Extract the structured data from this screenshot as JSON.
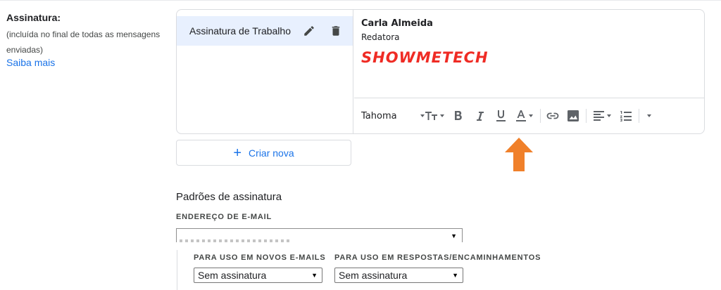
{
  "signature_section": {
    "label": "Assinatura:",
    "description": "(incluída no final de todas as mensagens enviadas)",
    "learn_more": "Saiba mais"
  },
  "signatures": [
    {
      "name": "Assinatura de Trabalho",
      "selected": true
    }
  ],
  "editor": {
    "name": "Carla Almeida",
    "role": "Redatora",
    "logo_text": "SHOWMETECH",
    "logo_color": "#ef2b24",
    "font": "Tahoma"
  },
  "create_new": {
    "label": "Criar nova"
  },
  "defaults": {
    "title": "Padrões de assinatura",
    "email_label": "ENDEREÇO DE E-MAIL",
    "new_emails_label": "PARA USO EM NOVOS E-MAILS",
    "replies_label": "PARA USO EM RESPOSTAS/ENCAMINHAMENTOS",
    "new_emails_value": "Sem assinatura",
    "replies_value": "Sem assinatura"
  },
  "colors": {
    "accent": "#1a73e8",
    "selected_bg": "#e8f0fe",
    "arrow": "#f0802a"
  }
}
